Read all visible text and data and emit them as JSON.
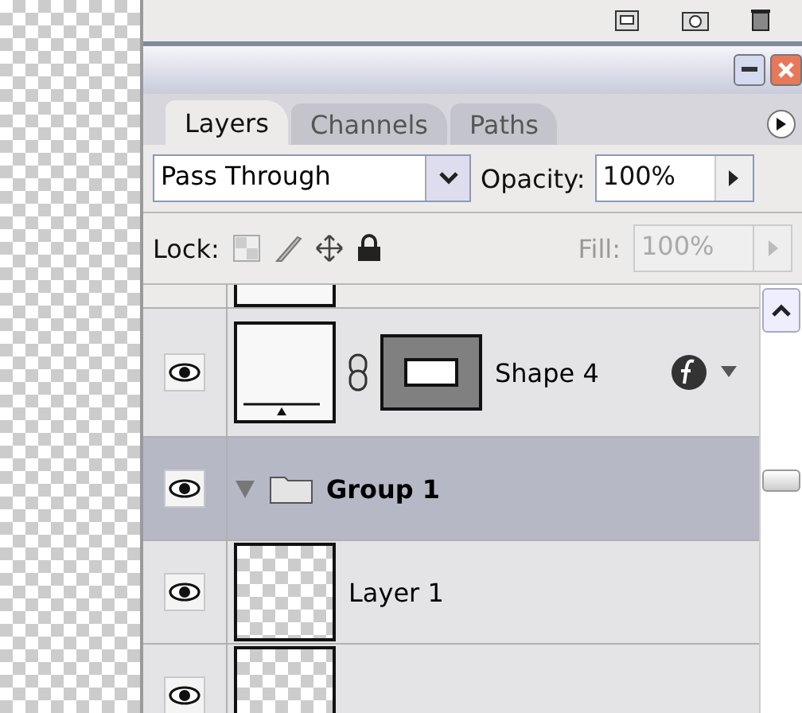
{
  "tabs": [
    {
      "label": "Layers",
      "selected": true
    },
    {
      "label": "Channels",
      "selected": false
    },
    {
      "label": "Paths",
      "selected": false
    }
  ],
  "blend_mode": {
    "value": "Pass Through"
  },
  "opacity": {
    "label": "Opacity:",
    "value": "100%"
  },
  "lock": {
    "label": "Lock:"
  },
  "fill": {
    "label": "Fill:",
    "value": "100%",
    "disabled": true
  },
  "layers": [
    {
      "kind": "shape",
      "name": "Shape 4",
      "visible": true,
      "selected": false
    },
    {
      "kind": "group",
      "name": "Group 1",
      "visible": true,
      "selected": true,
      "expanded": true,
      "children": [
        {
          "kind": "pixel",
          "name": "Layer 1",
          "visible": true,
          "selected": false
        },
        {
          "kind": "pixel",
          "visible": true,
          "selected": false
        }
      ]
    }
  ]
}
